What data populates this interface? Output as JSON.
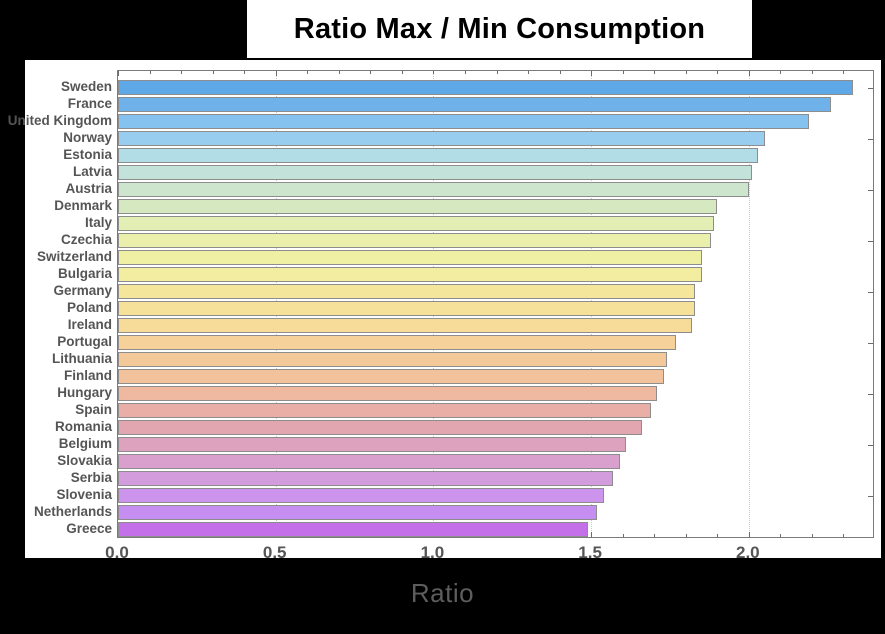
{
  "title": "Ratio Max / Min Consumption",
  "x_axis_title": "Ratio",
  "colors": {
    "background": "#000000",
    "panel": "#ffffff",
    "label_text": "#555555",
    "axis_title_text": "#5d5d5d",
    "frame": "#7a7a7a",
    "bar_border": "#8d8d8d",
    "gridline": "#c8c8c8"
  },
  "chart_data": {
    "type": "bar",
    "orientation": "horizontal",
    "title": "Ratio Max / Min Consumption",
    "xlabel": "Ratio",
    "ylabel": "",
    "xlim": [
      0.0,
      2.4
    ],
    "xticks": [
      0.0,
      0.5,
      1.0,
      1.5,
      2.0
    ],
    "xtick_labels": [
      "0.0",
      "0.5",
      "1.0",
      "1.5",
      "2.0"
    ],
    "grid": true,
    "legend": "none",
    "categories": [
      "Sweden",
      "France",
      "United Kingdom",
      "Norway",
      "Estonia",
      "Latvia",
      "Austria",
      "Denmark",
      "Italy",
      "Czechia",
      "Switzerland",
      "Bulgaria",
      "Germany",
      "Poland",
      "Ireland",
      "Portugal",
      "Lithuania",
      "Finland",
      "Hungary",
      "Spain",
      "Romania",
      "Belgium",
      "Slovakia",
      "Serbia",
      "Slovenia",
      "Netherlands",
      "Greece"
    ],
    "values": [
      2.33,
      2.26,
      2.19,
      2.05,
      2.03,
      2.01,
      2.0,
      1.9,
      1.89,
      1.88,
      1.85,
      1.85,
      1.83,
      1.83,
      1.82,
      1.77,
      1.74,
      1.73,
      1.71,
      1.69,
      1.66,
      1.61,
      1.59,
      1.57,
      1.54,
      1.52,
      1.49
    ],
    "bar_colors": [
      "#5fa8e8",
      "#6fb2ea",
      "#86c2ef",
      "#98cdf0",
      "#b2dde6",
      "#c2e2da",
      "#cde4cd",
      "#d6e8bf",
      "#e2eeb4",
      "#eaf0ab",
      "#f0f0a4",
      "#f2eda0",
      "#f4e79b",
      "#f5e199",
      "#f6dc98",
      "#f6d19a",
      "#f4c99a",
      "#f1c29c",
      "#eeb9a0",
      "#e9aea6",
      "#e2a6b0",
      "#dda2bd",
      "#d9a0cd",
      "#d39ddd",
      "#cc94ec",
      "#c68ef0",
      "#c470e8"
    ]
  }
}
